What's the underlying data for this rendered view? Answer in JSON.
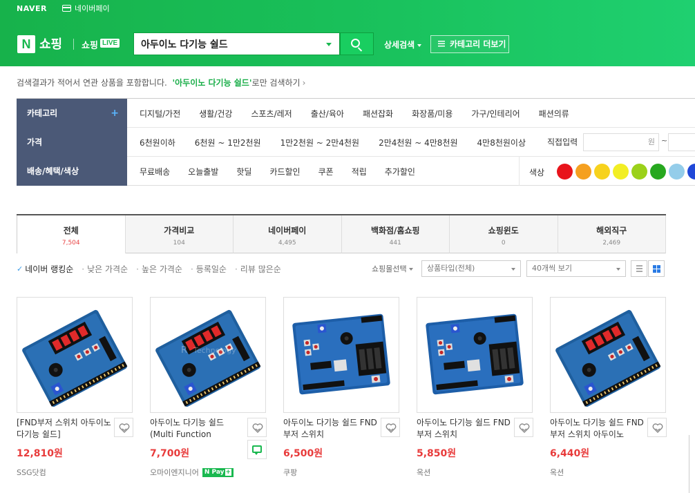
{
  "header": {
    "naver": "NAVER",
    "npay": "네이버페이",
    "logo_n": "N",
    "logo_text": "쇼핑",
    "live_text": "쇼핑",
    "live_badge": "LIVE",
    "search_value": "아두이노 다기능 쉴드",
    "detail_search": "상세검색",
    "category_more": "카테고리 더보기"
  },
  "notice": {
    "prefix": "검색결과가 적어서 연관 상품을 포함합니다.",
    "keyword": "'아두이노 다기능 쉴드'",
    "suffix": "로만 검색하기",
    "chevron": "›"
  },
  "filters": {
    "category": {
      "label": "카테고리",
      "plus": "+",
      "items": [
        "디지털/가전",
        "생활/건강",
        "스포츠/레저",
        "출산/육아",
        "패션잡화",
        "화장품/미용",
        "가구/인테리어",
        "패션의류"
      ]
    },
    "price": {
      "label": "가격",
      "items": [
        "6천원이하",
        "6천원 ~ 1만2천원",
        "1만2천원 ~ 2만4천원",
        "2만4천원 ~ 4만8천원",
        "4만8천원이상"
      ],
      "direct": "직접입력",
      "unit": "원",
      "tilde": "~"
    },
    "benefit": {
      "label": "배송/혜택/색상",
      "items": [
        "무료배송",
        "오늘출발",
        "핫딜",
        "카드할인",
        "쿠폰",
        "적립",
        "추가할인"
      ],
      "color_label": "색상"
    },
    "colors": [
      "#e8141b",
      "#f5a020",
      "#f7d21d",
      "#f2ee24",
      "#9bd11a",
      "#27a81f",
      "#94cdea",
      "#2048d8"
    ]
  },
  "tabs": [
    {
      "label": "전체",
      "count": "7,504"
    },
    {
      "label": "가격비교",
      "count": "104"
    },
    {
      "label": "네이버페이",
      "count": "4,495"
    },
    {
      "label": "백화점/홈쇼핑",
      "count": "441"
    },
    {
      "label": "쇼핑윈도",
      "count": "0"
    },
    {
      "label": "해외직구",
      "count": "2,469"
    }
  ],
  "sort": {
    "check": "✓",
    "active": "네이버 랭킹순",
    "options": [
      "낮은 가격순",
      "높은 가격순",
      "등록일순",
      "리뷰 많은순"
    ],
    "mall_select": "쇼핑몰선택",
    "product_type": "상품타입(전체)",
    "per_page": "40개씩 보기"
  },
  "products": [
    {
      "title": "[FND부저 스위치 아두이노 다기능 쉴드]",
      "price": "12,810원",
      "mall": "SSG닷컴"
    },
    {
      "title": "아두이노 다기능 쉴드 (Multi Function Shield)/Ar...",
      "price": "7,700원",
      "mall": "오마이엔지니어",
      "npay": "N Pay",
      "npay_plus": "+"
    },
    {
      "title": "아두이노 다기능 쉴드 FND부저 스위치",
      "price": "6,500원",
      "mall": "쿠팡"
    },
    {
      "title": "아두이노 다기능 쉴드 FND부저 스위치",
      "price": "5,850원",
      "mall": "옥션"
    },
    {
      "title": "아두이노 다기능 쉴드 FND부저 스위치 아두이노",
      "price": "6,440원",
      "mall": "옥션"
    }
  ],
  "thumb_watermark": "Technology",
  "thumb_watermark_prefix": "R"
}
